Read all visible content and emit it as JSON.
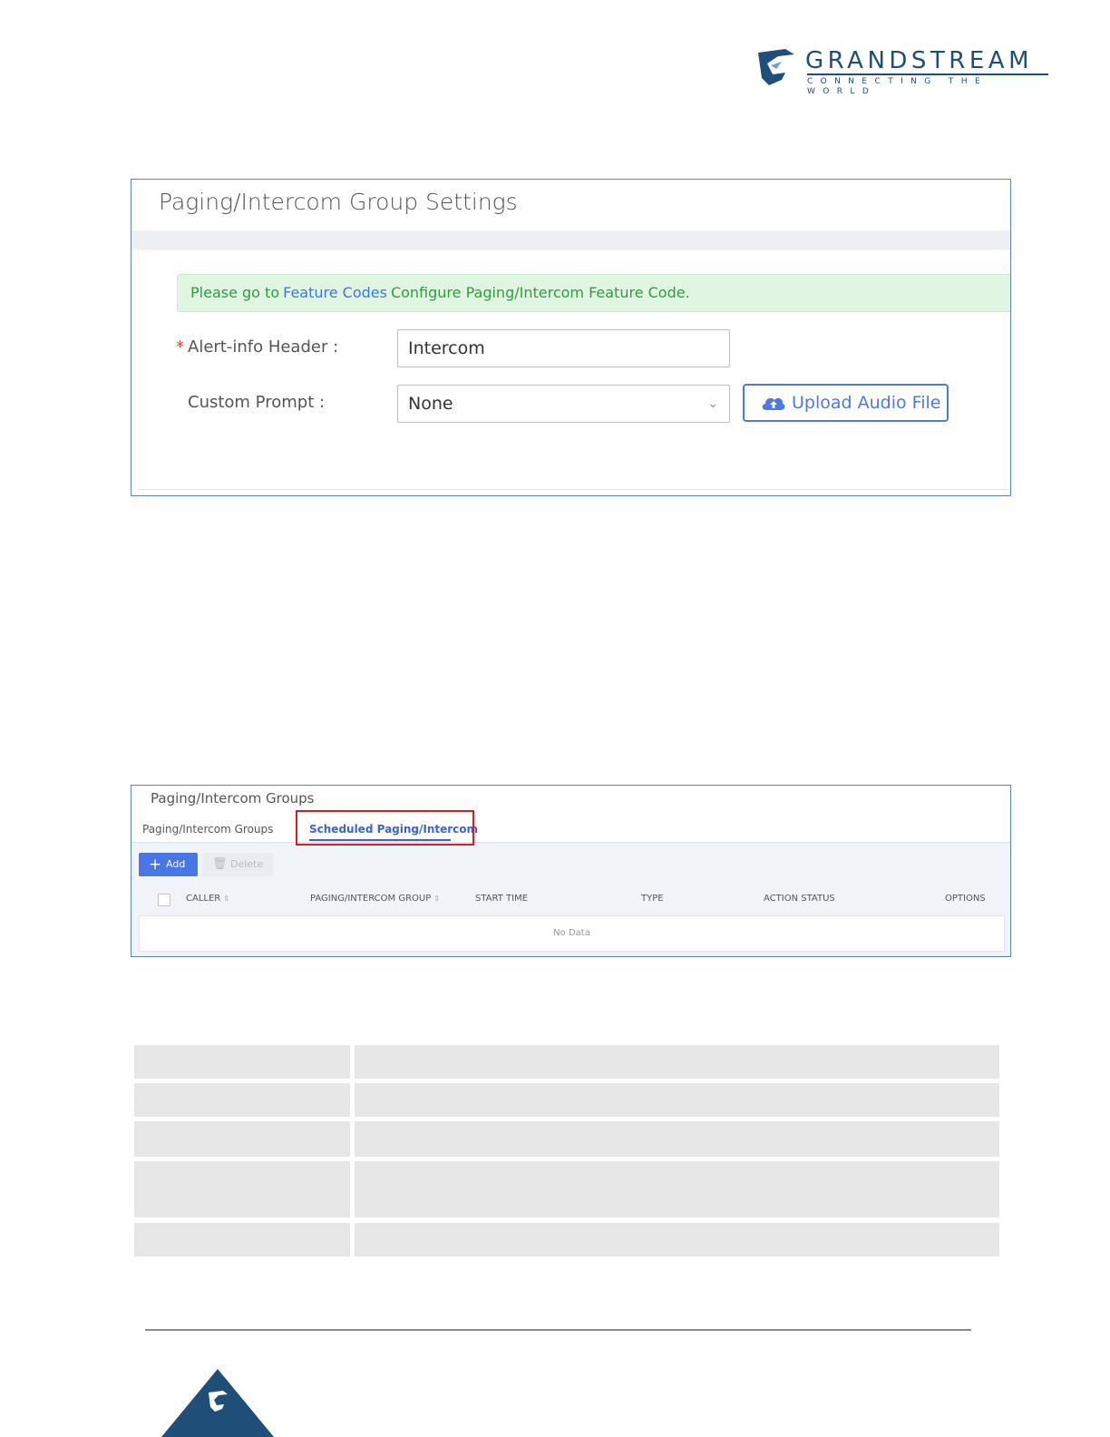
{
  "logo": {
    "brand": "GRANDSTREAM",
    "tagline": "CONNECTING THE WORLD",
    "brand_color": "#1f4e79"
  },
  "settings": {
    "title": "Paging/Intercom Group Settings",
    "notice": {
      "prefix": "Please go to",
      "link": "Feature Codes",
      "suffix": "Configure Paging/Intercom Feature Code."
    },
    "alert_info": {
      "required_mark": "*",
      "label": "Alert-info Header :",
      "value": "Intercom"
    },
    "custom_prompt": {
      "label": "Custom Prompt :",
      "selected": "None",
      "icon": "chevron-down-icon"
    },
    "upload_button": {
      "label": "Upload Audio File",
      "icon": "cloud-upload-icon",
      "color": "#4d78e6"
    },
    "notice_color": "#2e9e3c"
  },
  "groups": {
    "title": "Paging/Intercom Groups",
    "tabs": [
      "Paging/Intercom Groups",
      "Scheduled Paging/Intercom"
    ],
    "active_tab": "Scheduled Paging/Intercom",
    "add_label": "Add",
    "delete_label": "Delete",
    "columns": [
      "CALLER",
      "PAGING/INTERCOM GROUP",
      "START TIME",
      "TYPE",
      "ACTION STATUS",
      "OPTIONS"
    ],
    "empty_text": "No Data",
    "highlight_color": "#d21e24",
    "accent": "#4876e5"
  }
}
